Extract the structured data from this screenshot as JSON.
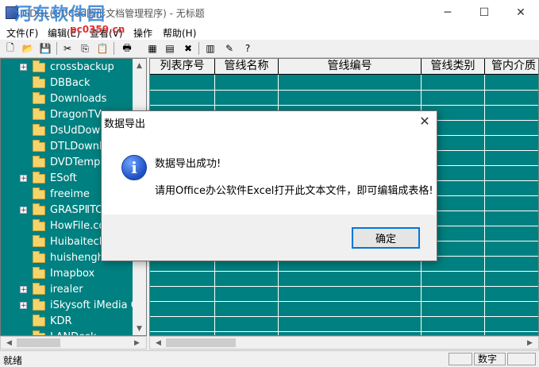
{
  "window": {
    "title": "GDGL(GDCad图形文档管理程序) - 无标题",
    "watermark": "河东软件园",
    "watermark_url": "pc0359.cn",
    "minimize_glyph": "─",
    "maximize_glyph": "☐",
    "close_glyph": "✕"
  },
  "menu": [
    {
      "label": "文件(F)"
    },
    {
      "label": "编辑(E)"
    },
    {
      "label": "查看(V)"
    },
    {
      "label": "操作"
    },
    {
      "label": "帮助(H)"
    }
  ],
  "toolbar": {
    "icons": [
      "new-file-icon",
      "open-folder-icon",
      "save-icon",
      "cut-icon",
      "copy-icon",
      "paste-icon",
      "print-icon",
      "grid-icon",
      "export-icon",
      "import-icon",
      "pages-icon",
      "pen-icon",
      "help-icon"
    ]
  },
  "tree": {
    "items": [
      {
        "label": "crossbackup",
        "expander": "+"
      },
      {
        "label": "DBBack",
        "expander": ""
      },
      {
        "label": "Downloads",
        "expander": ""
      },
      {
        "label": "DragonTV",
        "expander": ""
      },
      {
        "label": "DsUdDown",
        "expander": ""
      },
      {
        "label": "DTLDownLo",
        "expander": ""
      },
      {
        "label": "DVDTemp",
        "expander": ""
      },
      {
        "label": "ESoft",
        "expander": "+"
      },
      {
        "label": "freeime",
        "expander": ""
      },
      {
        "label": "GRASPⅡTC",
        "expander": "+"
      },
      {
        "label": "HowFile.co",
        "expander": ""
      },
      {
        "label": "HuibaitechD",
        "expander": ""
      },
      {
        "label": "huishenghu",
        "expander": ""
      },
      {
        "label": "Imapbox",
        "expander": ""
      },
      {
        "label": "irealer",
        "expander": "+"
      },
      {
        "label": "iSkysoft iMedia Co",
        "expander": "+"
      },
      {
        "label": "KDR",
        "expander": ""
      },
      {
        "label": "LANDesk",
        "expander": ""
      }
    ]
  },
  "grid": {
    "columns": [
      "列表序号",
      "管线名称",
      "管线编号",
      "管线类别",
      "管内介质"
    ]
  },
  "status": {
    "text": "就绪",
    "pane_num": "数字"
  },
  "dialog": {
    "title": "数据导出",
    "message1": "数据导出成功!",
    "message2": "请用Office办公软件Excel打开此文本文件，即可编辑成表格!",
    "ok_label": "确定",
    "icon_glyph": "i",
    "close_glyph": "✕"
  }
}
